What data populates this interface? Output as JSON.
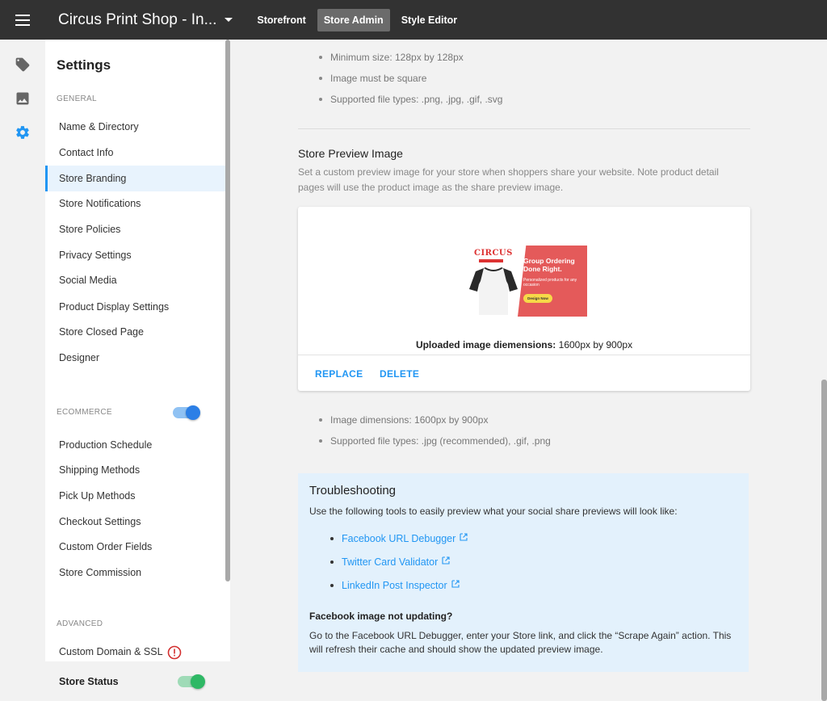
{
  "header": {
    "shop_title": "Circus Print Shop - In...",
    "tabs": [
      {
        "label": "Storefront",
        "active": false
      },
      {
        "label": "Store Admin",
        "active": true
      },
      {
        "label": "Style Editor",
        "active": false
      }
    ]
  },
  "rail": {
    "icons": [
      "tag-icon",
      "image-icon",
      "gear-icon"
    ],
    "active_icon": "gear-icon",
    "accent_color": "#2196f3"
  },
  "sidebar": {
    "title": "Settings",
    "general_label": "GENERAL",
    "general_items": [
      "Name & Directory",
      "Contact Info",
      "Store Branding",
      "Store Notifications",
      "Store Policies",
      "Privacy Settings",
      "Social Media",
      "Product Display Settings",
      "Store Closed Page",
      "Designer"
    ],
    "active_item": "Store Branding",
    "ecommerce_label": "ECOMMERCE",
    "ecommerce_enabled": true,
    "ecommerce_items": [
      "Production Schedule",
      "Shipping Methods",
      "Pick Up Methods",
      "Checkout Settings",
      "Custom Order Fields",
      "Store Commission"
    ],
    "advanced_label": "ADVANCED",
    "advanced_items": [
      "Custom Domain & SSL"
    ],
    "advanced_alert_icon": "alert-circle-icon",
    "store_status_label": "Store Status",
    "store_status_enabled": true
  },
  "main": {
    "logo_requirements": [
      "Minimum size: 128px by 128px",
      "Image must be square",
      "Supported file types: .png, .jpg, .gif, .svg"
    ],
    "preview_section": {
      "title": "Store Preview Image",
      "description": "Set a custom preview image for your store when shoppers share your website. Note product detail pages will use the product image as the share preview image.",
      "image": {
        "logo_text": "CIRCUS",
        "headline": "Group Ordering Done Right.",
        "subline": "Personalized products for any occasion",
        "button": "Design Now"
      },
      "dims_label": "Uploaded image diemensions:",
      "dims_value": "1600px by 900px",
      "replace_label": "REPLACE",
      "delete_label": "DELETE",
      "requirements": [
        "Image dimensions: 1600px by 900px",
        "Supported file types: .jpg (recommended), .gif, .png"
      ]
    },
    "troubleshooting": {
      "title": "Troubleshooting",
      "description": "Use the following tools to easily preview what your social share previews will look like:",
      "links": [
        "Facebook URL Debugger",
        "Twitter Card Validator",
        "LinkedIn Post Inspector"
      ],
      "subheading": "Facebook image not updating?",
      "note": "Go to the Facebook URL Debugger, enter your Store link, and click the “Scrape Again” action. This will refresh their cache and should show the updated preview image."
    }
  }
}
